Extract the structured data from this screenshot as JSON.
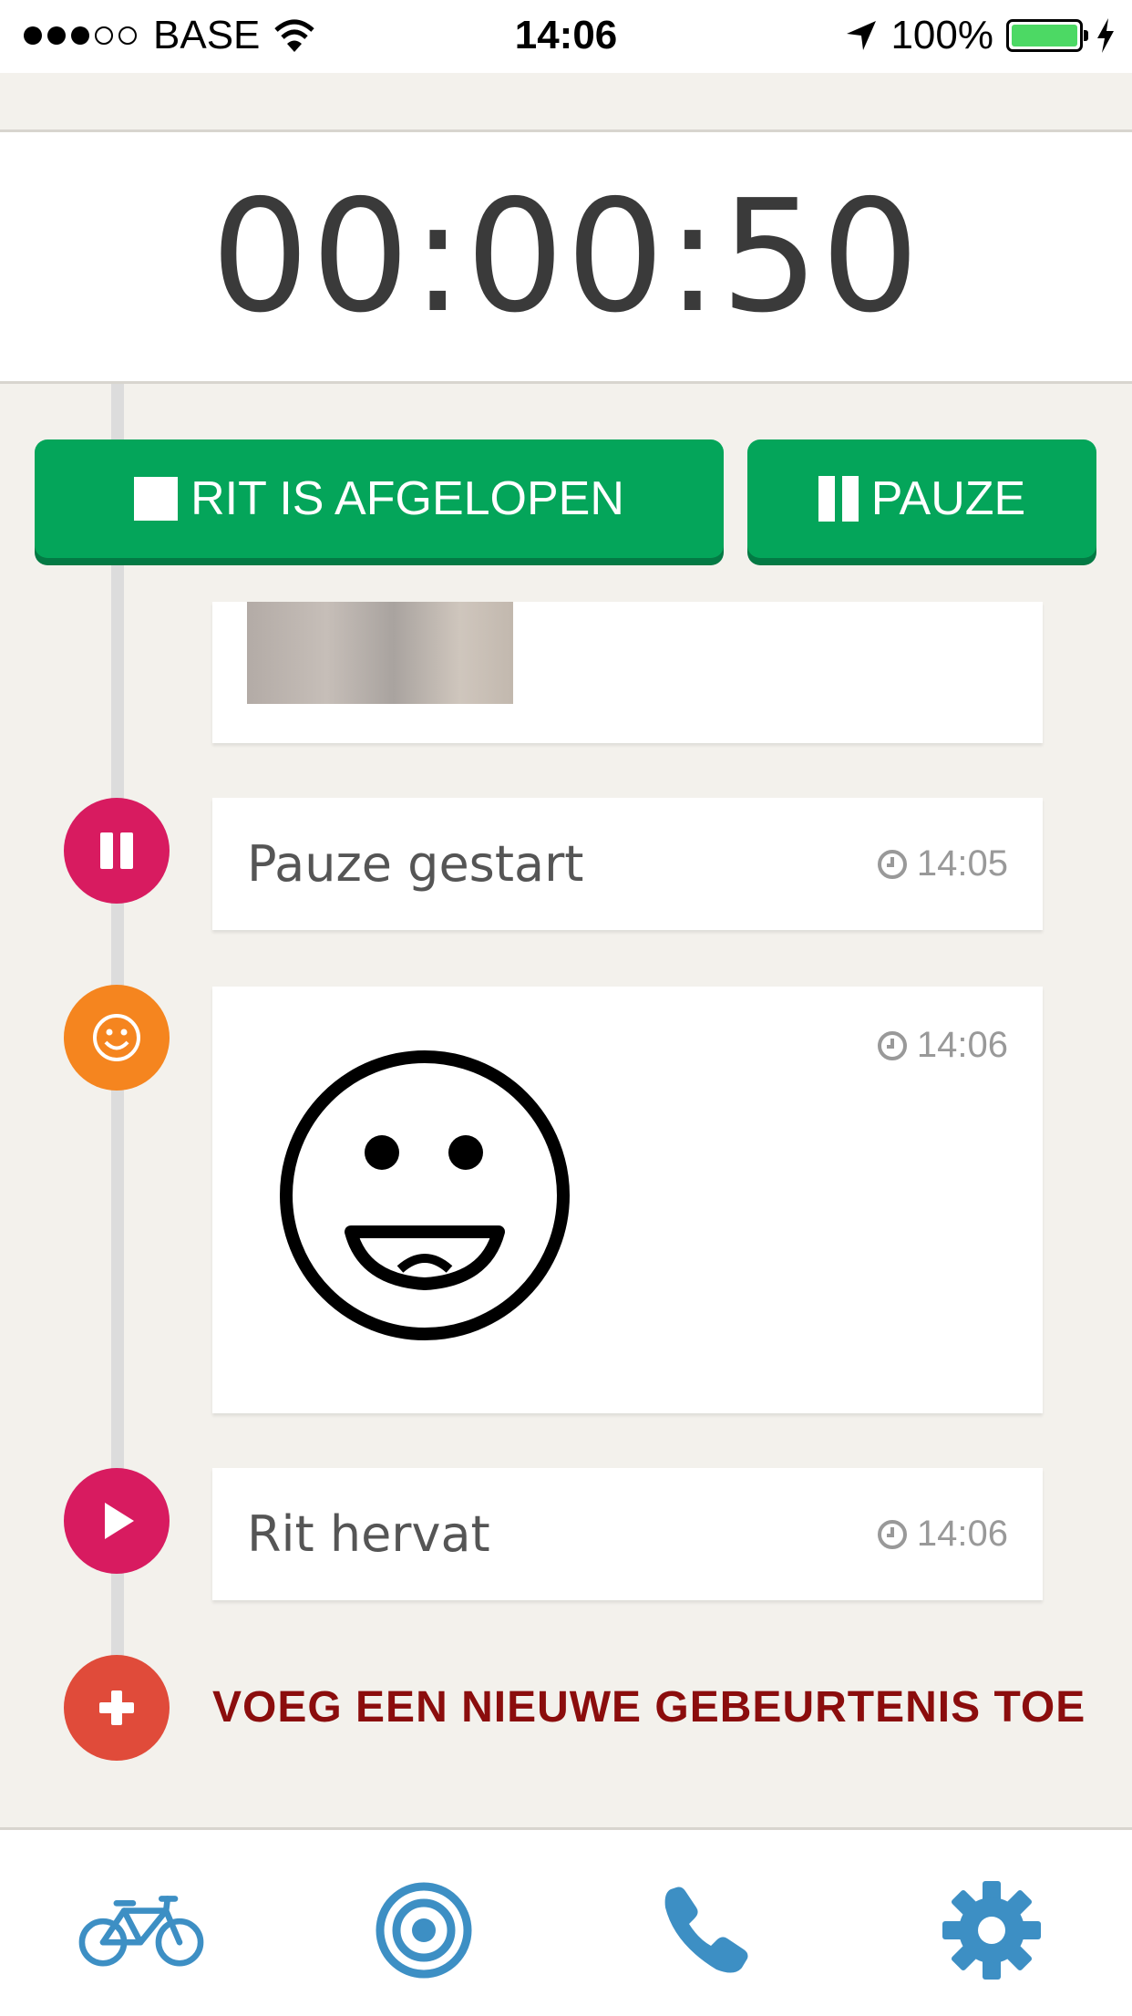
{
  "status_bar": {
    "carrier": "BASE",
    "time": "14:06",
    "battery": "100%",
    "icons": [
      "signal-dots-icon",
      "wifi-icon",
      "location-arrow-icon",
      "battery-icon",
      "charging-bolt-icon"
    ]
  },
  "timer": {
    "value": "00:00:50"
  },
  "actions": {
    "stop_label": "RIT IS AFGELOPEN",
    "pause_label": "PAUZE"
  },
  "timeline": {
    "events": [
      {
        "label": "Pauze gestart",
        "time": "14:05",
        "icon": "pause-icon"
      },
      {
        "label": "",
        "time": "14:06",
        "icon": "smiley-icon"
      },
      {
        "label": "Rit hervat",
        "time": "14:06",
        "icon": "play-icon"
      }
    ],
    "add_label": "VOEG EEN NIEUWE GEBEURTENIS TOE"
  },
  "bottom_nav": {
    "items": [
      "bicycle-icon",
      "target-icon",
      "phone-icon",
      "gear-icon"
    ]
  },
  "colors": {
    "green": "#04a55a",
    "magenta": "#d81b60",
    "orange": "#f5851f",
    "red": "#e04b3a",
    "dark_red_text": "#8b0d0d",
    "nav_blue": "#3d8fc4"
  }
}
